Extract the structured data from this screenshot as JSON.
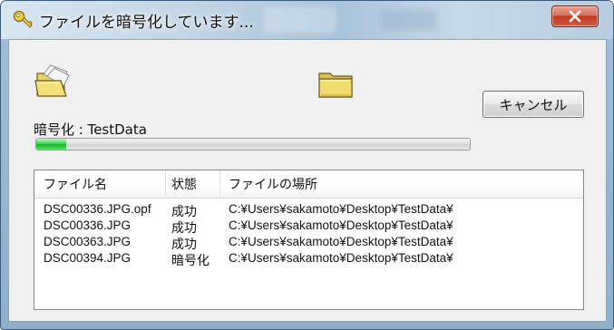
{
  "window": {
    "title": "ファイルを暗号化しています...",
    "close_label": "x"
  },
  "status": {
    "label": "暗号化 : TestData",
    "progress_fraction": 0.07
  },
  "buttons": {
    "cancel_label": "キャンセル"
  },
  "list": {
    "headers": {
      "name": "ファイル名",
      "state": "状態",
      "location": "ファイルの場所"
    },
    "rows": [
      {
        "name": "DSC00336.JPG.opf",
        "state": "成功",
        "location": "C:¥Users¥sakamoto¥Desktop¥TestData¥"
      },
      {
        "name": "DSC00336.JPG",
        "state": "成功",
        "location": "C:¥Users¥sakamoto¥Desktop¥TestData¥"
      },
      {
        "name": "DSC00363.JPG",
        "state": "成功",
        "location": "C:¥Users¥sakamoto¥Desktop¥TestData¥"
      },
      {
        "name": "DSC00394.JPG",
        "state": "暗号化",
        "location": "C:¥Users¥sakamoto¥Desktop¥TestData¥"
      }
    ]
  },
  "icons": {
    "title": "key-icon",
    "source": "open-folder-icon",
    "destination": "folder-icon",
    "close": "close-icon"
  }
}
